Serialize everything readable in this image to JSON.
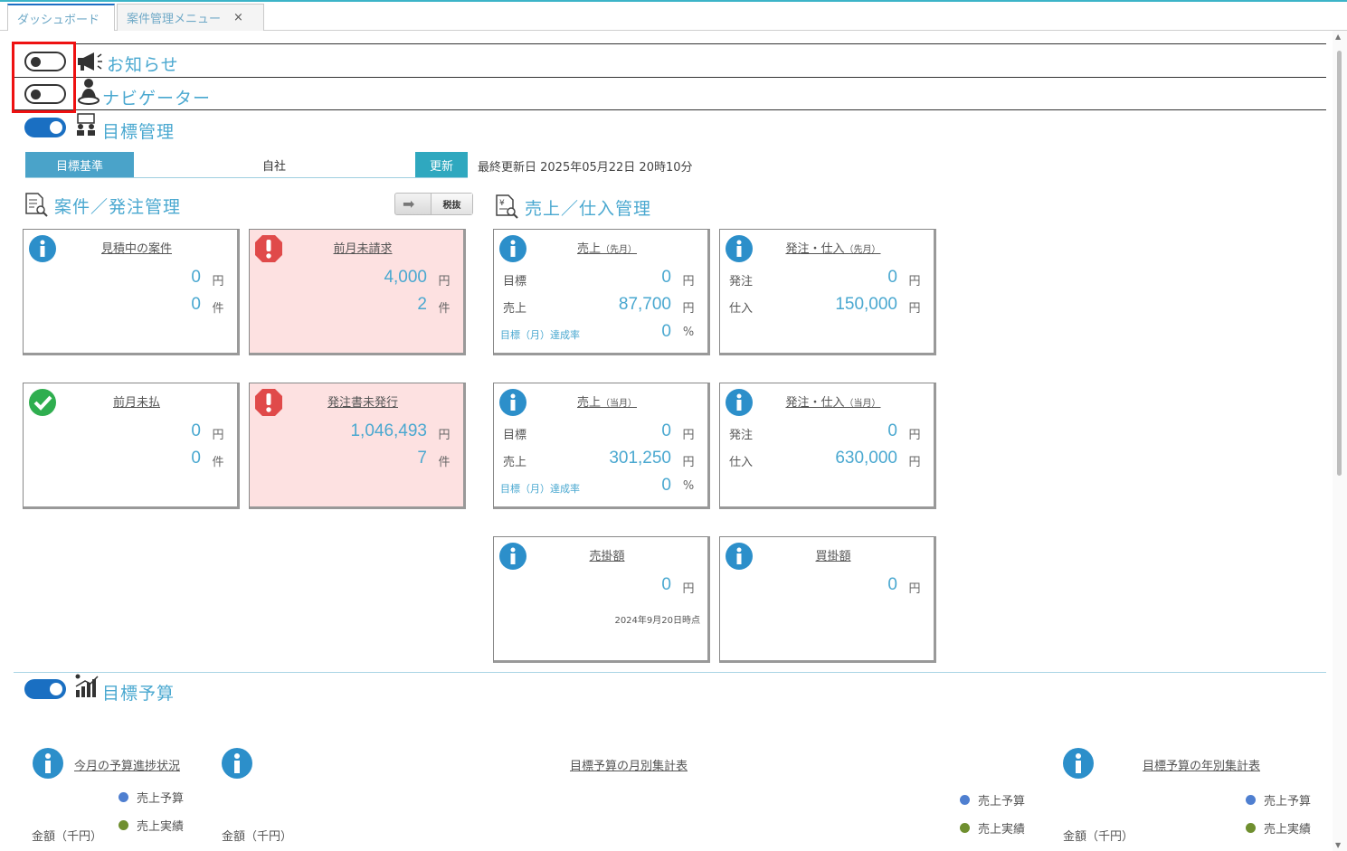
{
  "tabs": [
    {
      "label": "ダッシュボード",
      "active": true
    },
    {
      "label": "案件管理メニュー",
      "active": false,
      "close": "×"
    }
  ],
  "sections": {
    "notice": {
      "title": "お知らせ",
      "toggle": "off",
      "icon": "megaphone-icon"
    },
    "navigator": {
      "title": "ナビゲーター",
      "toggle": "off",
      "icon": "navigator-person-icon"
    },
    "goal": {
      "title": "目標管理",
      "toggle": "on",
      "icon": "goal-management-icon"
    },
    "budget": {
      "title": "目標予算",
      "toggle": "on",
      "icon": "budget-chart-icon"
    }
  },
  "target_bar": {
    "label": "目標基準",
    "value": "自社",
    "update_button": "更新"
  },
  "last_updated": "最終更新日 2025年05月22日 20時10分",
  "project_section": {
    "title": "案件／発注管理",
    "tax_switch": "税抜"
  },
  "sales_section": {
    "title": "売上／仕入管理"
  },
  "cards": {
    "estimating": {
      "title": "見積中の案件",
      "amount": "0",
      "amount_unit": "円",
      "count": "0",
      "count_unit": "件",
      "status": "info"
    },
    "unbilled": {
      "title": "前月未請求",
      "amount": "4,000",
      "amount_unit": "円",
      "count": "2",
      "count_unit": "件",
      "status": "alert"
    },
    "unpaid": {
      "title": "前月未払",
      "amount": "0",
      "amount_unit": "円",
      "count": "0",
      "count_unit": "件",
      "status": "ok"
    },
    "po_unissued": {
      "title": "発注書未発行",
      "amount": "1,046,493",
      "amount_unit": "円",
      "count": "7",
      "count_unit": "件",
      "status": "alert"
    },
    "sales_prev": {
      "title": "売上",
      "title_sub": "（先月）",
      "rows": [
        {
          "label": "目標",
          "value": "0",
          "unit": "円"
        },
        {
          "label": "売上",
          "value": "87,700",
          "unit": "円"
        },
        {
          "label": "目標（月）達成率",
          "value": "0",
          "unit": "%"
        }
      ]
    },
    "purchase_prev": {
      "title": "発注・仕入",
      "title_sub": "（先月）",
      "rows": [
        {
          "label": "発注",
          "value": "0",
          "unit": "円"
        },
        {
          "label": "仕入",
          "value": "150,000",
          "unit": "円"
        }
      ]
    },
    "sales_cur": {
      "title": "売上",
      "title_sub": "（当月）",
      "rows": [
        {
          "label": "目標",
          "value": "0",
          "unit": "円"
        },
        {
          "label": "売上",
          "value": "301,250",
          "unit": "円"
        },
        {
          "label": "目標（月）達成率",
          "value": "0",
          "unit": "%"
        }
      ]
    },
    "purchase_cur": {
      "title": "発注・仕入",
      "title_sub": "（当月）",
      "rows": [
        {
          "label": "発注",
          "value": "0",
          "unit": "円"
        },
        {
          "label": "仕入",
          "value": "630,000",
          "unit": "円"
        }
      ]
    },
    "receivable": {
      "title": "売掛額",
      "value": "0",
      "unit": "円",
      "note": "2024年9月20日時点"
    },
    "payable": {
      "title": "買掛額",
      "value": "0",
      "unit": "円"
    }
  },
  "budget": {
    "progress_title": "今月の予算進捗状況",
    "monthly_title": "目標予算の月別集計表",
    "yearly_title": "目標予算の年別集計表",
    "legend_plan": "売上予算",
    "legend_actual": "売上実績",
    "y_label": "金額（千円）",
    "colors": {
      "plan": "#4f7fd0",
      "actual": "#6f8f2f"
    }
  }
}
